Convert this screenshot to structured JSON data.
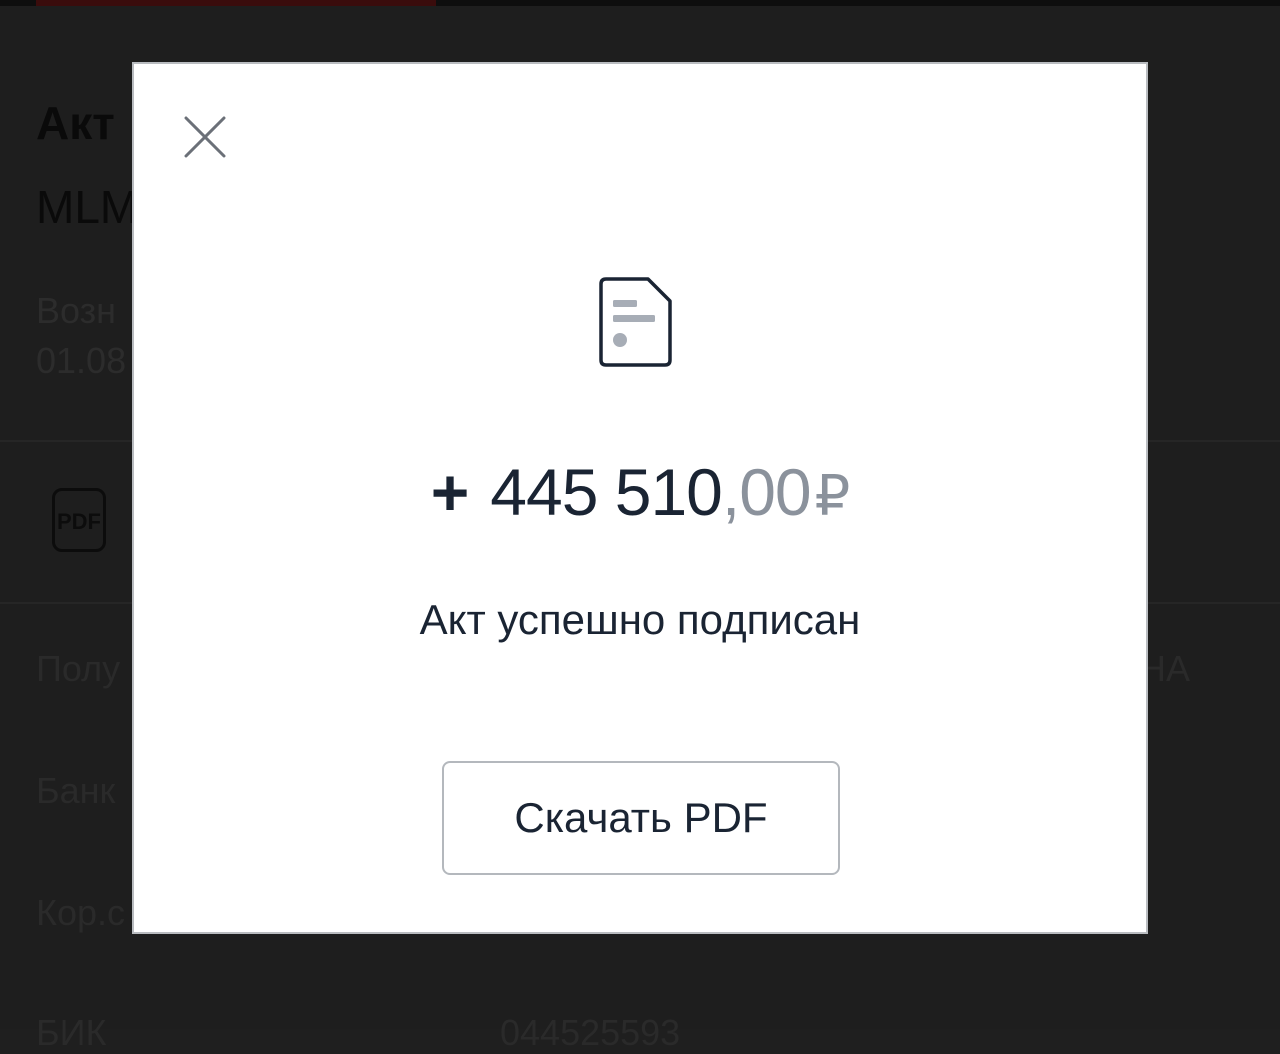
{
  "background": {
    "title": "Акт",
    "subtitle": "MLM",
    "meta_line1": "Возн",
    "meta_line2": "01.08",
    "pdf_icon_label": "PDF",
    "rows": [
      {
        "label": "Полу",
        "right": "НА"
      },
      {
        "label": "Банк"
      },
      {
        "label": "Кор.с"
      },
      {
        "label": "БИК",
        "value": "044525593"
      }
    ]
  },
  "modal": {
    "close_icon": "close-icon",
    "document_icon": "document-icon",
    "amount": {
      "sign": "+",
      "integer": "445 510",
      "fraction": ",00",
      "currency": "₽"
    },
    "status_text": "Акт успешно подписан",
    "download_button_label": "Скачать PDF"
  },
  "colors": {
    "overlay_background": "#1e1e1e",
    "text_primary": "#1a2433",
    "text_secondary": "#8b929c",
    "button_border": "#b4b8bd"
  }
}
